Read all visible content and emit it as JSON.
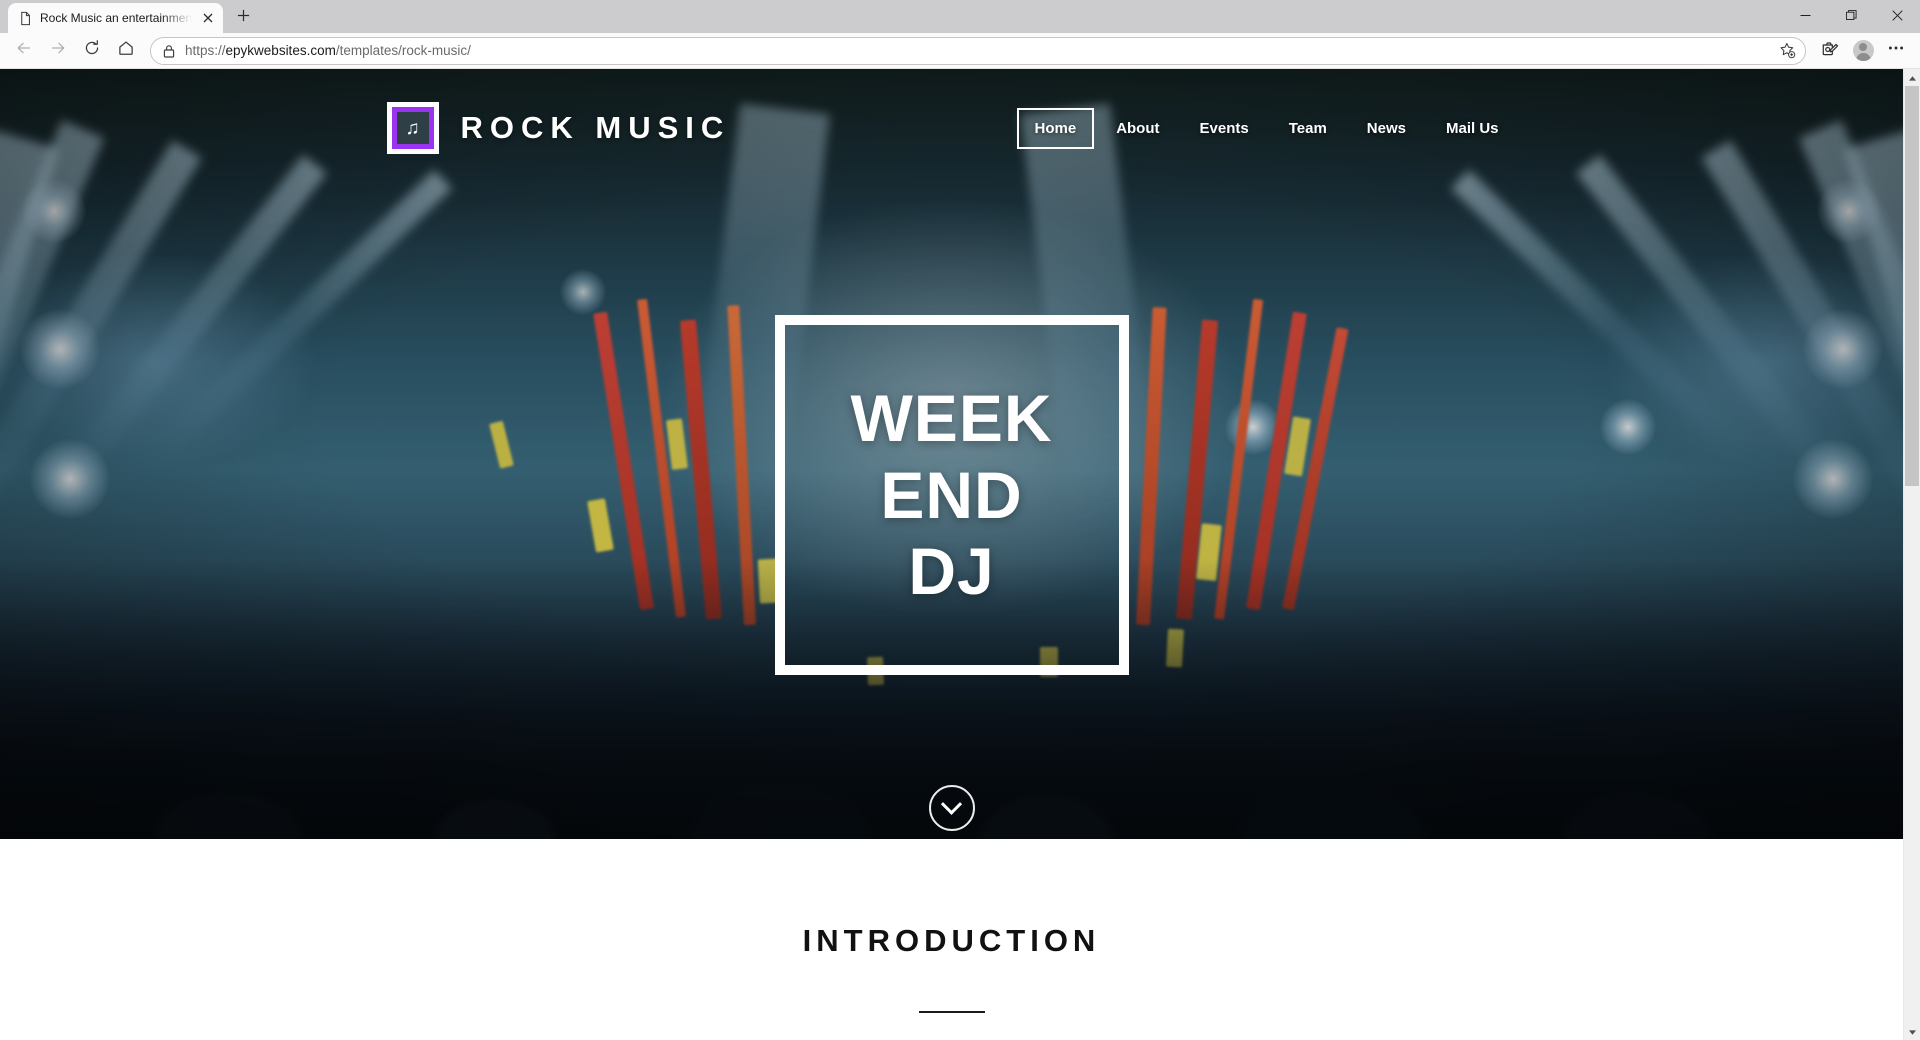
{
  "browser": {
    "tab": {
      "title": "Rock Music an entertainment Ca",
      "favicon_icon": "page-icon",
      "close_icon": "close-icon"
    },
    "new_tab_icon": "plus-icon",
    "window_controls": {
      "minimize_icon": "minimize-icon",
      "maximize_icon": "maximize-icon",
      "close_icon": "close-icon"
    },
    "toolbar": {
      "back_icon": "arrow-left-icon",
      "forward_icon": "arrow-right-icon",
      "reload_icon": "reload-icon",
      "home_icon": "home-icon",
      "lock_icon": "lock-icon",
      "favorite_icon": "star-add-icon",
      "collections_icon": "collections-icon",
      "profile_icon": "profile-avatar-icon",
      "settings_icon": "ellipsis-icon"
    },
    "address": {
      "scheme": "https://",
      "host": "epykwebsites.com",
      "path": "/templates/rock-music/",
      "full_url": "https://epykwebsites.com/templates/rock-music/"
    },
    "scrollbar": {
      "up_icon": "caret-up-icon",
      "down_icon": "caret-down-icon"
    }
  },
  "site": {
    "brand": {
      "name": "ROCK MUSIC",
      "logo_icon": "music-note-icon",
      "logo_accent_color": "#9b34f0"
    },
    "nav": [
      {
        "label": "Home",
        "active": true
      },
      {
        "label": "About",
        "active": false
      },
      {
        "label": "Events",
        "active": false
      },
      {
        "label": "Team",
        "active": false
      },
      {
        "label": "News",
        "active": false
      },
      {
        "label": "Mail Us",
        "active": false
      }
    ],
    "hero": {
      "line1": "WEEK",
      "line2": "END",
      "line3": "DJ",
      "scroll_icon": "chevron-down-icon"
    },
    "intro": {
      "heading": "INTRODUCTION"
    }
  }
}
